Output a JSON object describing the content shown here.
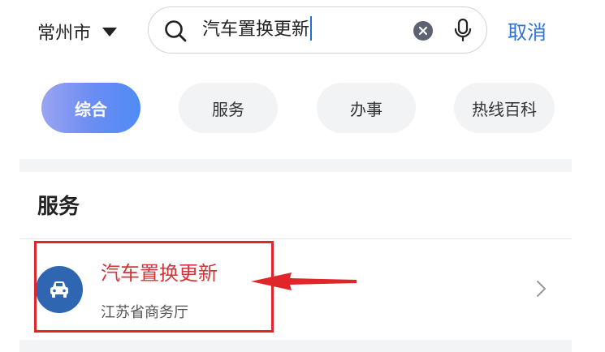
{
  "header": {
    "city": "常州市",
    "search_query": "汽车置换更新",
    "cancel_label": "取消"
  },
  "tabs": [
    {
      "label": "综合",
      "active": true
    },
    {
      "label": "服务",
      "active": false
    },
    {
      "label": "办事",
      "active": false
    },
    {
      "label": "热线百科",
      "active": false
    }
  ],
  "section": {
    "title": "服务"
  },
  "results": [
    {
      "title": "汽车置换更新",
      "subtitle": "江苏省商务厅",
      "icon": "car-icon"
    }
  ],
  "colors": {
    "accent_blue": "#2f73d9",
    "highlight_red": "#e0262b",
    "result_title_red": "#d2353a",
    "avatar_blue": "#2f66b1"
  }
}
